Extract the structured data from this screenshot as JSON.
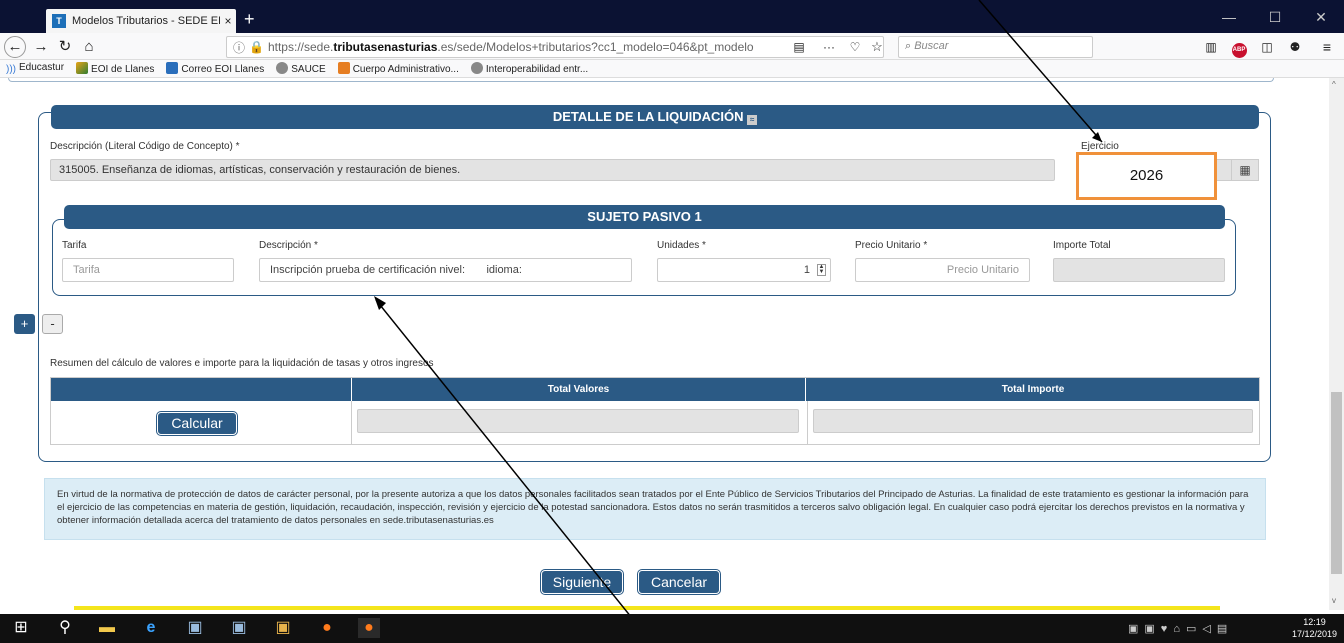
{
  "browser": {
    "tab_title": "Modelos Tributarios - SEDE ELE",
    "tab_close": "×",
    "new_tab": "+",
    "win_min": "—",
    "win_max": "☐",
    "win_close": "✕",
    "url_prefix": "https://sede.",
    "url_host": "tributasenasturias",
    "url_rest": ".es/sede/Modelos+tributarios?cc1_modelo=046&pt_modelo",
    "search_placeholder": "Buscar",
    "bookmarks": [
      "Educastur",
      "EOI de Llanes",
      "Correo EOI Llanes",
      "SAUCE",
      "Cuerpo Administrativo...",
      "Interoperabilidad entr..."
    ]
  },
  "detalle": {
    "heading": "DETALLE DE LA LIQUIDACIÓN",
    "descripcion_label": "Descripción (Literal Código de Concepto)",
    "descripcion_value": "315005. Enseñanza de idiomas, artísticas, conservación y restauración de bienes.",
    "ejercicio_label": "Ejercicio",
    "ejercicio_value": "2026",
    "required_mark": "*"
  },
  "sujeto": {
    "heading": "SUJETO PASIVO 1",
    "tarifa_label": "Tarifa",
    "tarifa_placeholder": "Tarifa",
    "descripcion_label": "Descripción",
    "descripcion_value": "Inscripción prueba de certificación nivel:       idioma:",
    "unidades_label": "Unidades",
    "unidades_value": "1",
    "precio_label": "Precio Unitario",
    "precio_placeholder": "Precio Unitario",
    "importe_label": "Importe Total"
  },
  "controls": {
    "add": "+",
    "remove": "-"
  },
  "resumen": {
    "caption": "Resumen del cálculo de valores e importe para la liquidación de tasas y otros ingresos",
    "col_valores": "Total Valores",
    "col_importe": "Total Importe",
    "calcular": "Calcular"
  },
  "privacy": {
    "text": "En virtud de la normativa de protección de datos de carácter personal, por la presente autoriza a que los datos personales facilitados sean tratados por el Ente Público de Servicios Tributarios del Principado de Asturias. La finalidad de este tratamiento es gestionar la información para el ejercicio de las competencias en materia de gestión, liquidación, recaudación, inspección, revisión y ejercicio de la potestad sancionadora. Estos datos no serán trasmitidos a terceros salvo obligación legal. En cualquier caso podrá ejercitar los derechos previstos en la normativa y obtener información detallada acerca del tratamiento de datos personales en",
    "link": "sede.tributasenasturias.es"
  },
  "footer": {
    "siguiente": "Siguiente",
    "cancelar": "Cancelar"
  },
  "taskbar": {
    "time": "12:19",
    "date": "17/12/2019"
  },
  "colors": {
    "header_blue": "#2b5a85",
    "highlight_orange": "#f0913a",
    "privacy_bg": "#dcedf6"
  }
}
